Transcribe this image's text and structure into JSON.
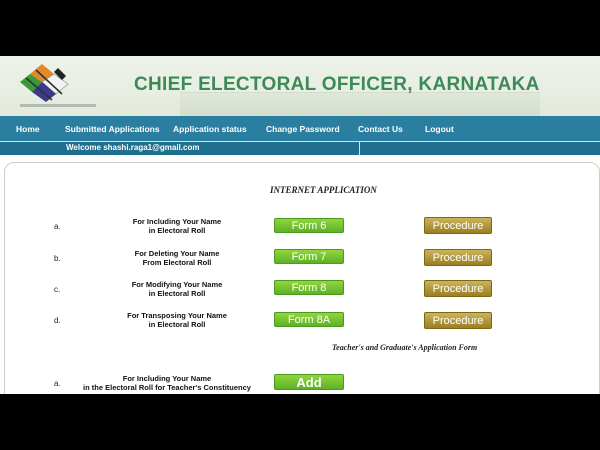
{
  "header": {
    "title": "CHIEF ELECTORAL OFFICER, KARNATAKA"
  },
  "nav": {
    "items": [
      "Home",
      "Submitted Applications",
      "Application status",
      "Change Password",
      "Contact Us",
      "Logout"
    ]
  },
  "welcome": "Welcome shashi.raga1@gmail.com",
  "content": {
    "section_title": "INTERNET APPLICATION",
    "rows": [
      {
        "letter": "a.",
        "line1": "For Including Your Name",
        "line2": "in Electoral Roll",
        "form": "Form 6",
        "procedure": "Procedure"
      },
      {
        "letter": "b.",
        "line1": "For Deleting Your Name",
        "line2": "From Electoral Roll",
        "form": "Form 7",
        "procedure": "Procedure"
      },
      {
        "letter": "c.",
        "line1": "For Modifying Your Name",
        "line2": "in Electoral Roll",
        "form": "Form 8",
        "procedure": "Procedure"
      },
      {
        "letter": "d.",
        "line1": "For Transposing Your Name",
        "line2": "in Electoral Roll",
        "form": "Form 8A",
        "procedure": "Procedure"
      }
    ],
    "tg_title": "Teacher's and Graduate's Application Form",
    "tg_row": {
      "letter": "a.",
      "line1": "For Including Your Name",
      "line2": "in the Electoral Roll for Teacher's Constituency",
      "button": "Add"
    }
  },
  "colors": {
    "nav": "#2a7fa0",
    "title": "#3d8a58",
    "form_button": "#6cbf2e",
    "procedure_button": "#a8902e"
  }
}
